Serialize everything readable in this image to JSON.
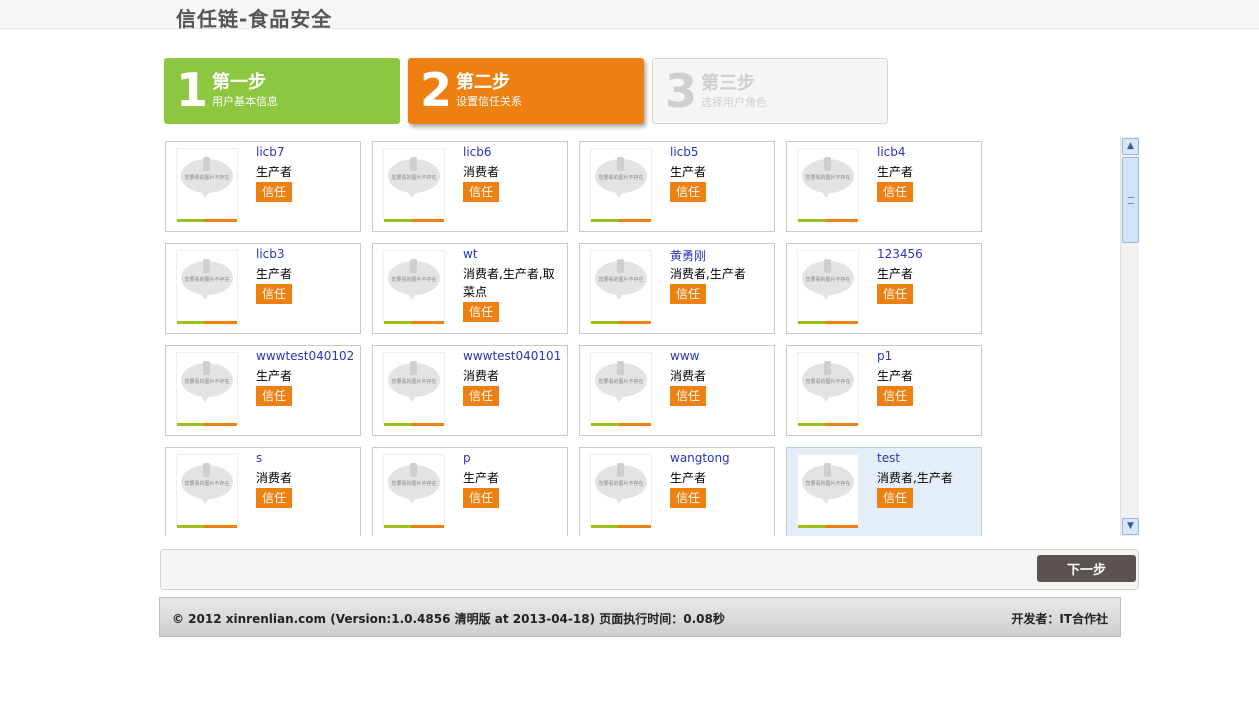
{
  "site": {
    "title": "信任链-食品安全"
  },
  "steps": [
    {
      "number": "1",
      "title": "第一步",
      "subtitle": "用户基本信息"
    },
    {
      "number": "2",
      "title": "第二步",
      "subtitle": "设置信任关系"
    },
    {
      "number": "3",
      "title": "第三步",
      "subtitle": "选择用户角色"
    }
  ],
  "avatar_placeholder_text": "您要看的图片不存在",
  "users": [
    {
      "name": "licb7",
      "role": "生产者",
      "trust_label": "信任"
    },
    {
      "name": "licb6",
      "role": "消费者",
      "trust_label": "信任"
    },
    {
      "name": "licb5",
      "role": "生产者",
      "trust_label": "信任"
    },
    {
      "name": "licb4",
      "role": "生产者",
      "trust_label": "信任"
    },
    {
      "name": "licb3",
      "role": "生产者",
      "trust_label": "信任"
    },
    {
      "name": "wt",
      "role": "消费者,生产者,取菜点",
      "trust_label": "信任"
    },
    {
      "name": "黄勇刚",
      "role": "消费者,生产者",
      "trust_label": "信任"
    },
    {
      "name": "123456",
      "role": "生产者",
      "trust_label": "信任"
    },
    {
      "name": "wwwtest040102",
      "role": "生产者",
      "trust_label": "信任"
    },
    {
      "name": "wwwtest040101",
      "role": "消费者",
      "trust_label": "信任"
    },
    {
      "name": "www",
      "role": "消费者",
      "trust_label": "信任"
    },
    {
      "name": "p1",
      "role": "生产者",
      "trust_label": "信任"
    },
    {
      "name": "s",
      "role": "消费者",
      "trust_label": "信任"
    },
    {
      "name": "p",
      "role": "生产者",
      "trust_label": "信任"
    },
    {
      "name": "wangtong",
      "role": "生产者",
      "trust_label": "信任"
    },
    {
      "name": "test",
      "role": "消费者,生产者",
      "trust_label": "信任"
    }
  ],
  "actions": {
    "next_label": "下一步"
  },
  "footer": {
    "copyright": "© 2012 xinrenlian.com (Version:1.0.4856 清明版 at 2013-04-18)   页面执行时间：0.08秒",
    "developer": "开发者：IT合作社"
  },
  "scrollbar": {
    "up_icon": "arrow-up-icon",
    "down_icon": "arrow-down-icon"
  },
  "colors": {
    "green": "#8dc63f",
    "orange": "#ee8012",
    "link_blue": "#2a35b8",
    "button_dark": "#5b5352"
  }
}
